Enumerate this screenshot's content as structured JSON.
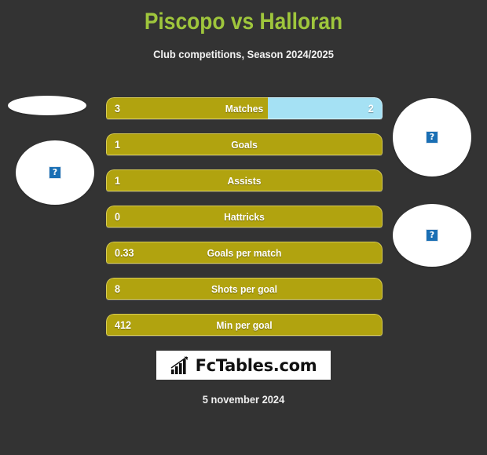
{
  "header": {
    "title": "Piscopo vs Halloran",
    "subtitle": "Club competitions, Season 2024/2025",
    "title_color": "#9fc63c"
  },
  "theme": {
    "background": "#333333",
    "home_color": "#b1a30f",
    "away_color": "#a5e1f4",
    "text_color": "#ffffff"
  },
  "avatars": {
    "home_flag": {
      "icon": "broken-image-icon",
      "glyph": ""
    },
    "home_photo": {
      "icon": "broken-image-icon",
      "glyph": "?"
    },
    "away_photo": {
      "icon": "broken-image-icon",
      "glyph": "?"
    },
    "away_flag": {
      "icon": "broken-image-icon",
      "glyph": "?"
    }
  },
  "stats": [
    {
      "label": "Matches",
      "home": "3",
      "away": "2",
      "home_pct": 58.5,
      "away_pct": 41.5,
      "split": true
    },
    {
      "label": "Goals",
      "home": "1",
      "away": "",
      "home_pct": 100,
      "away_pct": 0,
      "split": false
    },
    {
      "label": "Assists",
      "home": "1",
      "away": "",
      "home_pct": 100,
      "away_pct": 0,
      "split": false
    },
    {
      "label": "Hattricks",
      "home": "0",
      "away": "",
      "home_pct": 100,
      "away_pct": 0,
      "split": false
    },
    {
      "label": "Goals per match",
      "home": "0.33",
      "away": "",
      "home_pct": 100,
      "away_pct": 0,
      "split": false
    },
    {
      "label": "Shots per goal",
      "home": "8",
      "away": "",
      "home_pct": 100,
      "away_pct": 0,
      "split": false
    },
    {
      "label": "Min per goal",
      "home": "412",
      "away": "",
      "home_pct": 100,
      "away_pct": 0,
      "split": false
    }
  ],
  "footer": {
    "logo_text": "FcTables.com",
    "logo_icon": "bar-chart-growth-icon",
    "date": "5 november 2024"
  }
}
